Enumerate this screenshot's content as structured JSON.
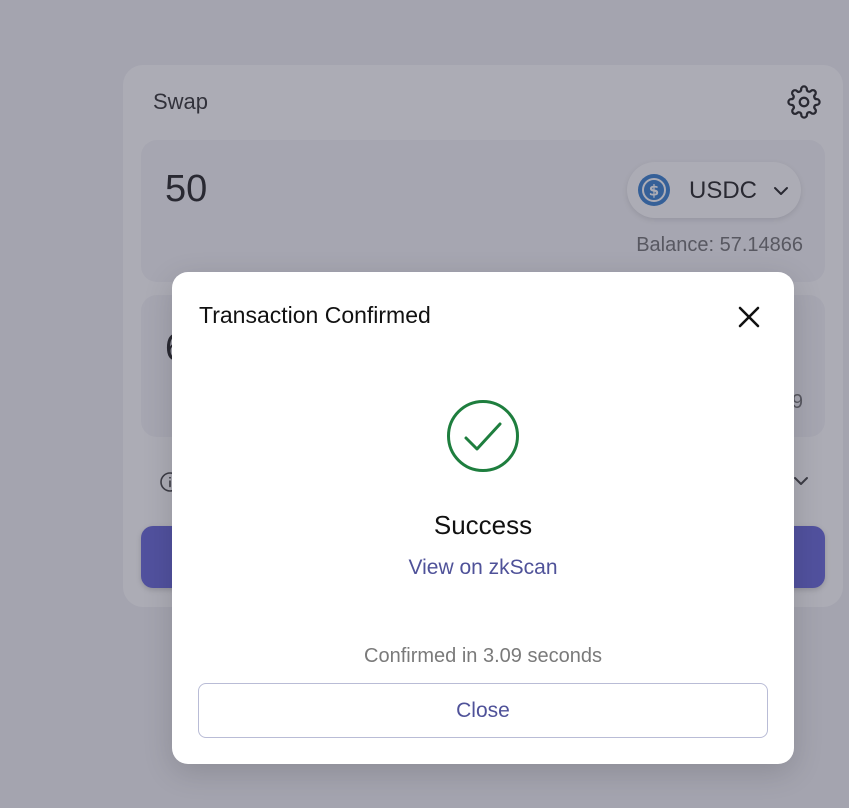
{
  "swap": {
    "title": "Swap",
    "settings_icon": "gear-icon",
    "from": {
      "amount": "50",
      "token_symbol": "USDC",
      "token_icon": "usdc-coin-icon",
      "balance_label": "Balance: 57.14866"
    },
    "to": {
      "amount_visible": "6",
      "balance_visible": "9"
    }
  },
  "modal": {
    "title": "Transaction Confirmed",
    "status": "Success",
    "explorer_link": "View on zkScan",
    "confirm_time": "Confirmed in 3.09 seconds",
    "close_label": "Close"
  },
  "colors": {
    "accent": "#4f5299",
    "success": "#1e7e3e",
    "swap_button": "#5a5ad6",
    "usdc": "#2775ca"
  }
}
